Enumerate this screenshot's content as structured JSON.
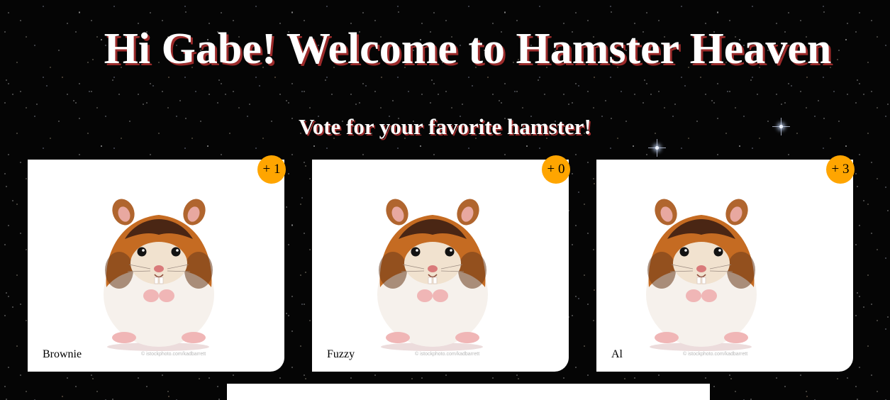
{
  "header": {
    "title": "Hi Gabe! Welcome to Hamster Heaven",
    "subtitle": "Vote for your favorite hamster!"
  },
  "cards": [
    {
      "name": "Brownie",
      "votes_label": "+ 1",
      "votes": 1,
      "photo_credit": "© istockphoto.com/kadbarrett"
    },
    {
      "name": "Fuzzy",
      "votes_label": "+ 0",
      "votes": 0,
      "photo_credit": "© istockphoto.com/kadbarrett"
    },
    {
      "name": "Al",
      "votes_label": "+ 3",
      "votes": 3,
      "photo_credit": "© istockphoto.com/kadbarrett"
    }
  ],
  "colors": {
    "badge": "#ffa500",
    "title_shadow": "#9c2b2b",
    "card_background": "#ffffff",
    "page_background": "#050505"
  },
  "icons": {
    "hamster_photo": "hamster-photo"
  }
}
